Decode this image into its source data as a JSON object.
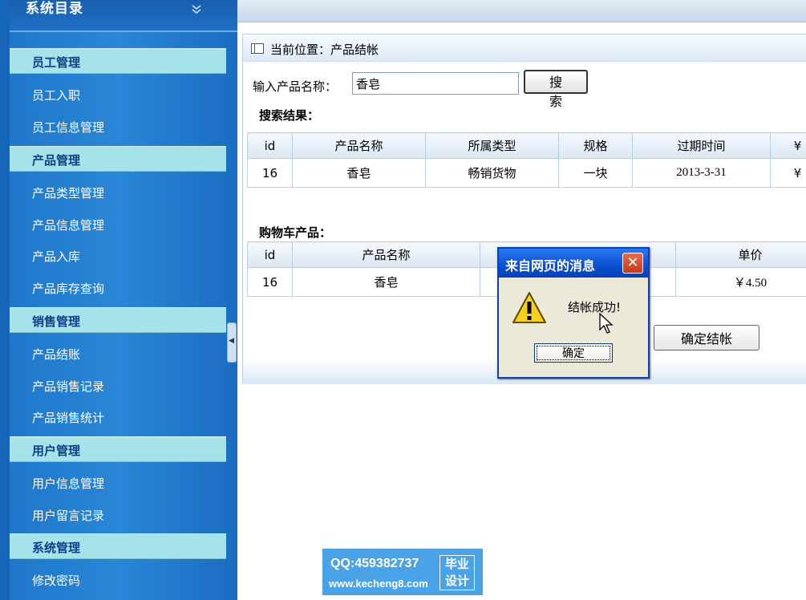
{
  "sidebar": {
    "title": "系统目录",
    "collapse_icon": "double-chevron-down-icon",
    "sections": [
      {
        "label": "员工管理",
        "items": [
          "员工入职",
          "员工信息管理"
        ]
      },
      {
        "label": "产品管理",
        "items": [
          "产品类型管理",
          "产品信息管理",
          "产品入库",
          "产品库存查询"
        ]
      },
      {
        "label": "销售管理",
        "items": [
          "产品结账",
          "产品销售记录",
          "产品销售统计"
        ]
      },
      {
        "label": "用户管理",
        "items": [
          "用户信息管理",
          "用户留言记录"
        ]
      },
      {
        "label": "系统管理",
        "items": [
          "修改密码"
        ]
      }
    ]
  },
  "panel": {
    "location": "当前位置：产品结帐",
    "search_label": "输入产品名称：",
    "search_value": "香皂",
    "search_button": "搜  索",
    "search_results_label": "搜索结果：",
    "search_table": {
      "columns": [
        "id",
        "产品名称",
        "所属类型",
        "规格",
        "过期时间",
        "¥"
      ],
      "rows": [
        [
          "16",
          "香皂",
          "畅销货物",
          "一块",
          "2013-3-31",
          "¥"
        ]
      ]
    },
    "cart_label": "购物车产品：",
    "cart_table": {
      "columns": [
        "id",
        "产品名称",
        "",
        "单价"
      ],
      "rows": [
        [
          "16",
          "香皂",
          "",
          "￥4.50"
        ]
      ]
    },
    "confirm_button": "确定结帐"
  },
  "dialog": {
    "title": "来自网页的消息",
    "message": "结帐成功!",
    "ok_button": "确定",
    "icon": "warning-icon",
    "close_icon": "close-icon"
  },
  "watermark": {
    "qq": "QQ:459382737",
    "url": "www.kecheng8.com",
    "badge_line1": "毕业",
    "badge_line2": "设计"
  },
  "colors": {
    "sidebar_bg": "#2a86d6",
    "section_bg": "#a6e2ea",
    "dialog_title_bg": "#0a4fd0"
  }
}
